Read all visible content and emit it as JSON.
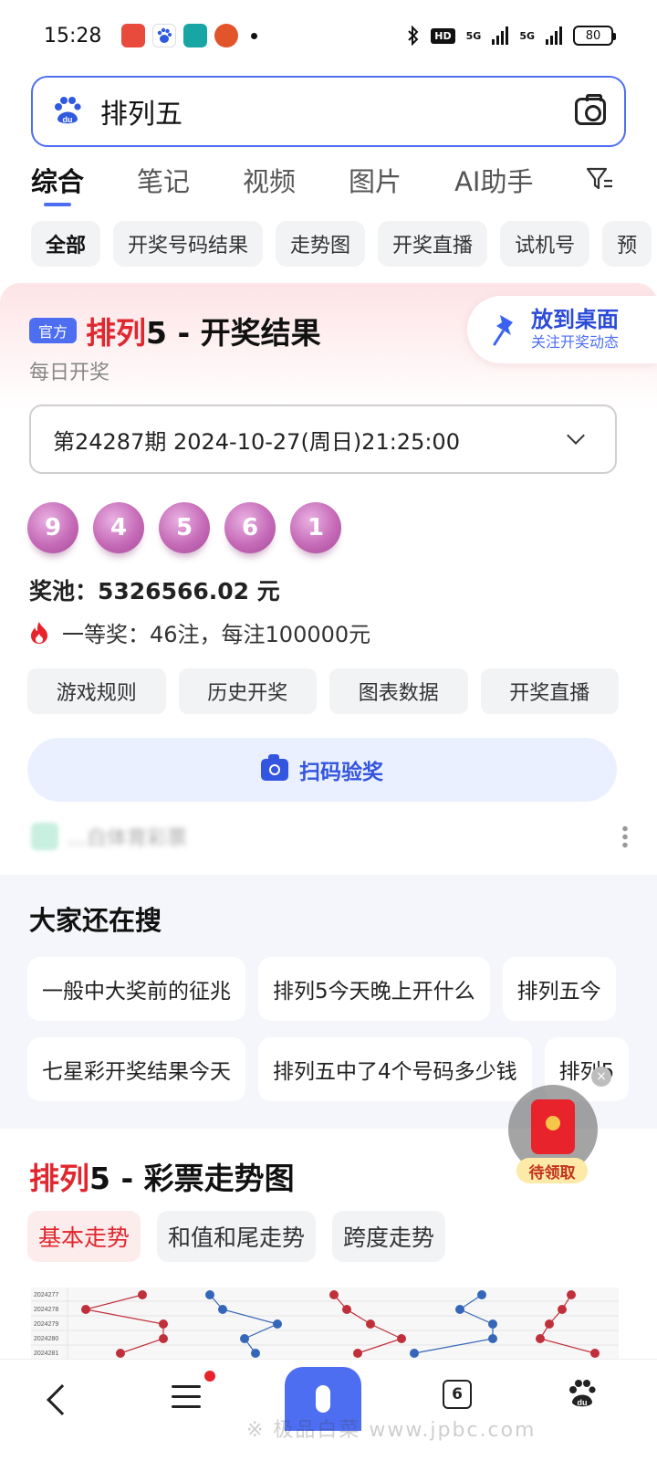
{
  "status": {
    "time": "15:28",
    "hd_badge": "HD",
    "signal1": "5G",
    "signal2": "5G",
    "battery": "80"
  },
  "search": {
    "query": "排列五"
  },
  "tabs": [
    {
      "label": "综合"
    },
    {
      "label": "笔记"
    },
    {
      "label": "视频"
    },
    {
      "label": "图片"
    },
    {
      "label": "AI助手"
    }
  ],
  "chips": [
    {
      "label": "全部"
    },
    {
      "label": "开奖号码结果"
    },
    {
      "label": "走势图"
    },
    {
      "label": "开奖直播"
    },
    {
      "label": "试机号"
    },
    {
      "label": "预"
    }
  ],
  "result_card": {
    "badge": "官方",
    "title_red": "排列",
    "title_rest": "5 - 开奖结果",
    "subtitle": "每日开奖",
    "pin_title": "放到桌面",
    "pin_sub": "关注开奖动态",
    "period": "第24287期 2024-10-27(周日)21:25:00",
    "balls": [
      "9",
      "4",
      "5",
      "6",
      "1"
    ],
    "pool": "奖池：5326566.02 元",
    "first_prize": "一等奖：46注，每注100000元",
    "actions": [
      {
        "label": "游戏规则"
      },
      {
        "label": "历史开奖"
      },
      {
        "label": "图表数据"
      },
      {
        "label": "开奖直播"
      }
    ],
    "scan_label": "扫码验奖",
    "source_text": "...白体育彩票"
  },
  "also_search": {
    "title": "大家还在搜",
    "row1": [
      "一般中大奖前的征兆",
      "排列5今天晚上开什么",
      "排列五今"
    ],
    "row2": [
      "七星彩开奖结果今天",
      "排列五中了4个号码多少钱",
      "排列5"
    ]
  },
  "trend": {
    "title_red": "排列",
    "title_rest": "5 - 彩票走势图",
    "tabs": [
      {
        "label": "基本走势"
      },
      {
        "label": "和值和尾走势"
      },
      {
        "label": "跨度走势"
      }
    ],
    "periods": [
      "2024277",
      "2024278",
      "2024279",
      "2024280",
      "2024281"
    ]
  },
  "red_packet": {
    "label": "待领取"
  },
  "bottom_nav": {
    "tabs_count": "6",
    "watermark": "※ 极品白菜 www.jpbc.com"
  },
  "colors": {
    "accent": "#4e6ef2",
    "red": "#e0272f",
    "ball": "#c66bb8"
  }
}
